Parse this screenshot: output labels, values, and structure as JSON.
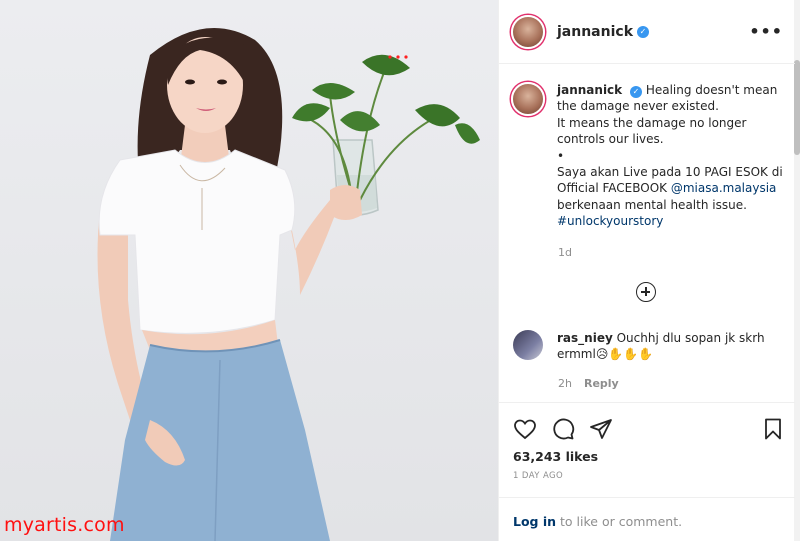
{
  "post": {
    "username": "jannanick",
    "more_label": "•••"
  },
  "caption": {
    "username": "jannanick",
    "line1": " Healing doesn't mean the damage never existed.",
    "line2": "It means the damage no longer controls our lives.",
    "bullet": "•",
    "line3_start": "Saya akan Live pada 10 PAGI ESOK di Official FACEBOOK ",
    "mention": "@miasa.malaysia",
    "line3_end": " berkenaan mental health issue.",
    "hashtag": "#unlockyourstory",
    "time": "1d"
  },
  "comment": {
    "username": "ras_niey",
    "text": " Ouchhj dlu sopan jk skrh ermml😥✋✋✋",
    "time": "2h",
    "reply_label": "Reply"
  },
  "likes": {
    "count_text": "63,243 likes",
    "time_ago": "1 DAY AGO"
  },
  "login": {
    "link_text": "Log in",
    "rest_text": " to like or comment."
  },
  "watermark": "myartis.com",
  "colors": {
    "link_blue": "#00376b",
    "verified_blue": "#3897f0",
    "secondary_text": "#8e8e8e",
    "watermark_red": "#ff1010"
  }
}
